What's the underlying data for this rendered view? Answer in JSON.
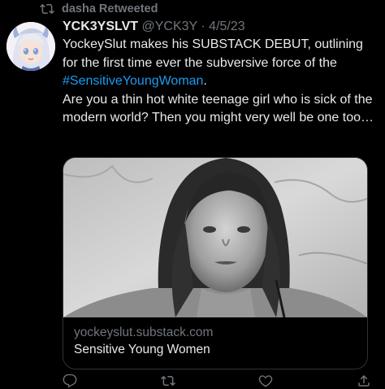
{
  "retweet": {
    "label": "dasha Retweeted"
  },
  "tweet": {
    "display_name": "YCK3YSLVT",
    "handle": "@YCK3Y",
    "separator": "·",
    "date": "4/5/23",
    "text_part1": "YockeySlut makes his SUBSTACK DEBUT, outlining for the first time ever the subversive force of the ",
    "hashtag": "#SensitiveYoungWoman",
    "text_part2": ".",
    "text_part3": "Are you a thin hot white teenage girl who is sick of the modern world? Then you might very well be one too…"
  },
  "card": {
    "domain": "yockeyslut.substack.com",
    "title": "Sensitive Young Women"
  },
  "actions": {
    "reply_icon": "reply-icon",
    "retweet_icon": "retweet-icon",
    "like_icon": "like-icon",
    "share_icon": "share-icon"
  },
  "colors": {
    "background": "#000000",
    "text": "#e7e9ea",
    "muted": "#71767b",
    "link": "#1d9bf0",
    "border": "#2f3336"
  }
}
